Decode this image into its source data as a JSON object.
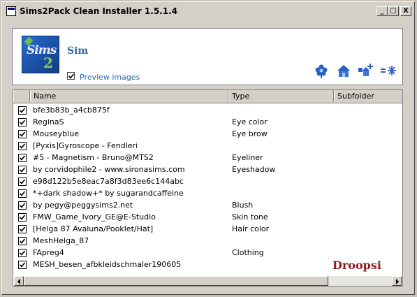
{
  "window": {
    "title": "Sims2Pack Clean Installer 1.5.1.4",
    "controls": {
      "minimize": "_",
      "maximize": "□",
      "close": "X"
    }
  },
  "header": {
    "package_name": "Sim",
    "preview_label": "Preview images",
    "preview_checked": true,
    "toolbar_icons": [
      "flower-icon",
      "home-icon",
      "lot-add-icon",
      "snowflake-arrow-icon"
    ]
  },
  "list": {
    "columns": [
      "Name",
      "Type",
      "Subfolder"
    ],
    "rows": [
      {
        "checked": true,
        "name": "bfe3b83b_a4cb875f",
        "type": ""
      },
      {
        "checked": true,
        "name": "ReginaS",
        "type": "Eye color"
      },
      {
        "checked": true,
        "name": "Mouseyblue",
        "type": "Eye brow"
      },
      {
        "checked": true,
        "name": "[Pyxis]Gyroscope - Fendleri",
        "type": ""
      },
      {
        "checked": true,
        "name": "#5 - Magnetism - Bruno@MTS2",
        "type": "Eyeliner"
      },
      {
        "checked": true,
        "name": "by corvidophile2 - www.sironasims.com",
        "type": "Eyeshadow"
      },
      {
        "checked": true,
        "name": "e98d122b5e8eac7a8f3d83ee6c144abc",
        "type": ""
      },
      {
        "checked": true,
        "name": "*+dark shadow+* by sugarandcaffeine",
        "type": ""
      },
      {
        "checked": true,
        "name": "by pegy@peggysims2.net",
        "type": "Blush"
      },
      {
        "checked": true,
        "name": "FMW_Game_Ivory_GE@E-Studio",
        "type": "Skin tone"
      },
      {
        "checked": true,
        "name": "[Helga 87 Avaluna/Pooklet/Hat]",
        "type": "Hair color"
      },
      {
        "checked": true,
        "name": "MeshHelga_87",
        "type": ""
      },
      {
        "checked": true,
        "name": "FApreg4",
        "type": "Clothing"
      },
      {
        "checked": true,
        "name": "MESH_besen_afbkleidschmaler190605",
        "type": ""
      }
    ]
  },
  "watermark": "Droopsi",
  "colors": {
    "accent_blue": "#2b6aa8",
    "watermark_red": "#8b1a1a",
    "window_bg": "#d4d0c8"
  }
}
